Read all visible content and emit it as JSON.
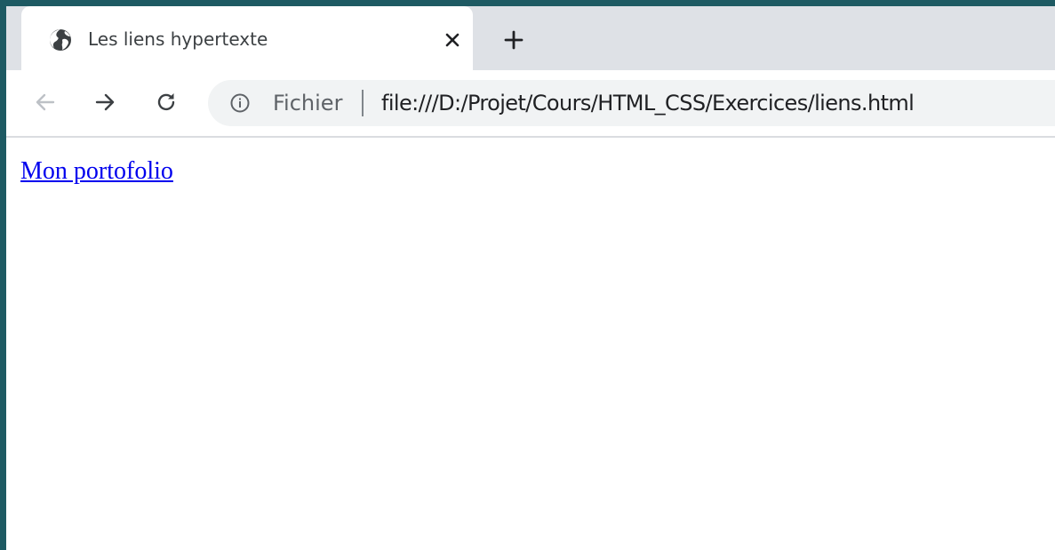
{
  "tab": {
    "title": "Les liens hypertexte",
    "favicon": "globe-icon",
    "close_icon": "close-icon"
  },
  "new_tab_icon": "plus-icon",
  "toolbar": {
    "back_icon": "arrow-left-icon",
    "forward_icon": "arrow-right-icon",
    "reload_icon": "reload-icon"
  },
  "omnibox": {
    "security_icon": "info-icon",
    "security_label": "Fichier",
    "url": "file:///D:/Projet/Cours/HTML_CSS/Exercices/liens.html"
  },
  "page": {
    "link_text": "Mon portofolio"
  },
  "colors": {
    "link": "#0000ee",
    "tabstrip": "#dee1e6",
    "omnibox": "#f1f3f4",
    "outer_background": "#1e5a63"
  }
}
